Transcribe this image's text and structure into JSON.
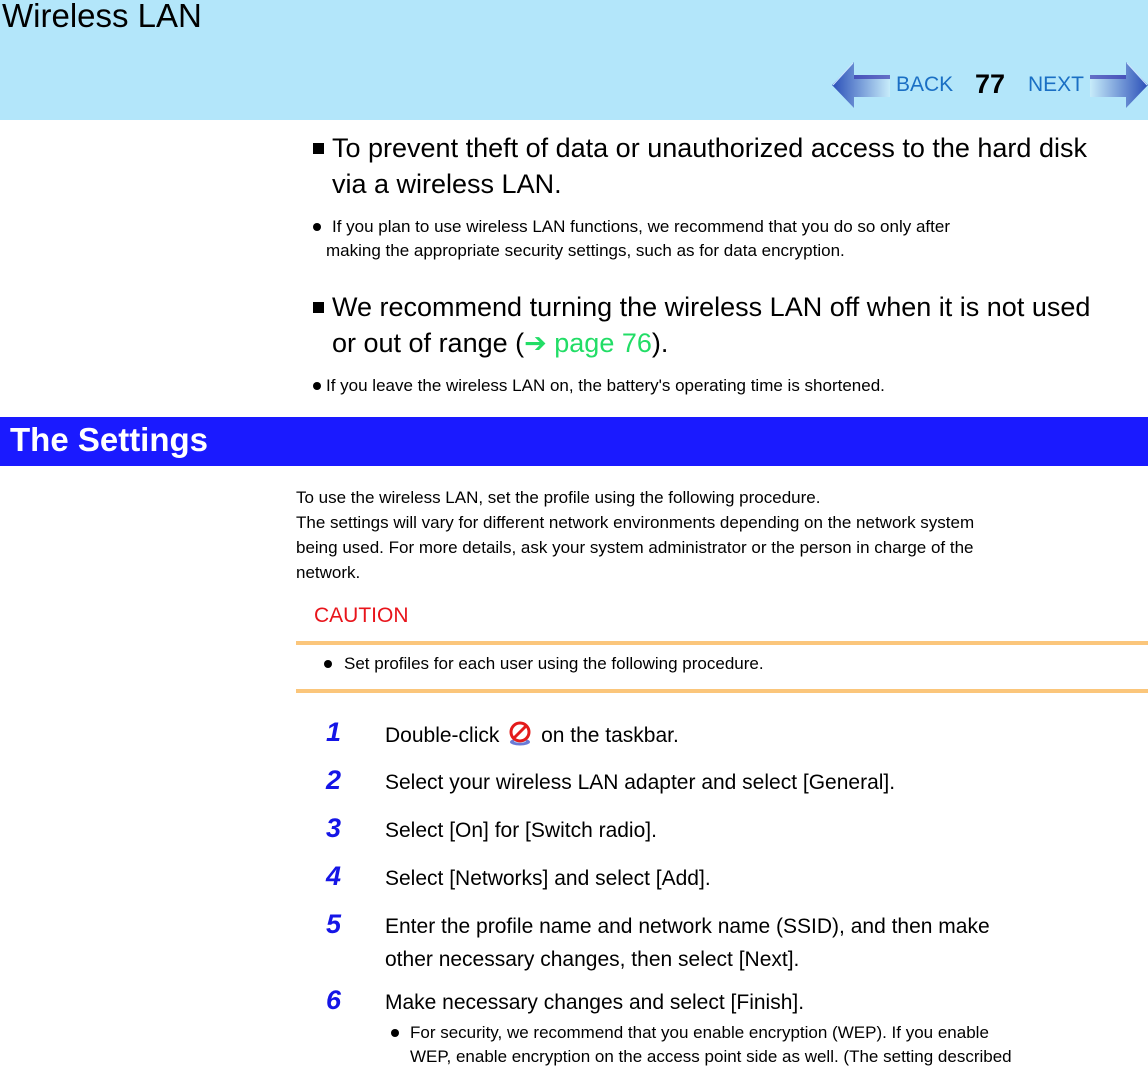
{
  "header": {
    "title": "Wireless LAN",
    "back_label": "BACK",
    "page_number": "77",
    "next_label": "NEXT"
  },
  "intro": {
    "heading1": "To prevent theft of data or unauthorized access to the hard disk",
    "heading1_cont": "via a wireless LAN.",
    "bullet1_line1": "If you plan to use wireless LAN functions, we recommend that you do so only after",
    "bullet1_line2": "making the appropriate security settings, such as for data encryption.",
    "heading2": "We recommend turning the wireless LAN off when it is not used",
    "heading2_cont_prefix": "or out of range (",
    "heading2_link_arrow": "➔",
    "heading2_link": "page 76",
    "heading2_cont_suffix": ").",
    "bullet2": "If you leave the wireless LAN on, the battery's operating time is shortened."
  },
  "section": {
    "title": "The Settings",
    "para_lines": [
      "To use the wireless LAN, set the profile using the following procedure.",
      "The settings will vary for different network environments depending on the network system",
      "being used. For more details, ask your system administrator or the person in charge of the",
      "network."
    ]
  },
  "caution": {
    "label": "CAUTION",
    "bullet": "Set profiles for each user using the following procedure."
  },
  "steps": [
    {
      "num": "1",
      "text_before_icon": "Double-click",
      "icon": "wireless-tray-icon",
      "text_after_icon": "on the taskbar."
    },
    {
      "num": "2",
      "text": "Select your wireless LAN adapter and select [General]."
    },
    {
      "num": "3",
      "text": "Select [On] for [Switch radio]."
    },
    {
      "num": "4",
      "text": "Select [Networks] and select [Add]."
    },
    {
      "num": "5",
      "text": "Enter the profile name and network name (SSID), and then make",
      "text_cont": "other necessary changes, then select [Next]."
    },
    {
      "num": "6",
      "text": "Make necessary changes and select [Finish].",
      "bullet_line1": "For security, we recommend that you enable encryption (WEP). If you enable",
      "bullet_line2": "WEP, enable encryption on the access point side as well. (The setting described"
    }
  ]
}
